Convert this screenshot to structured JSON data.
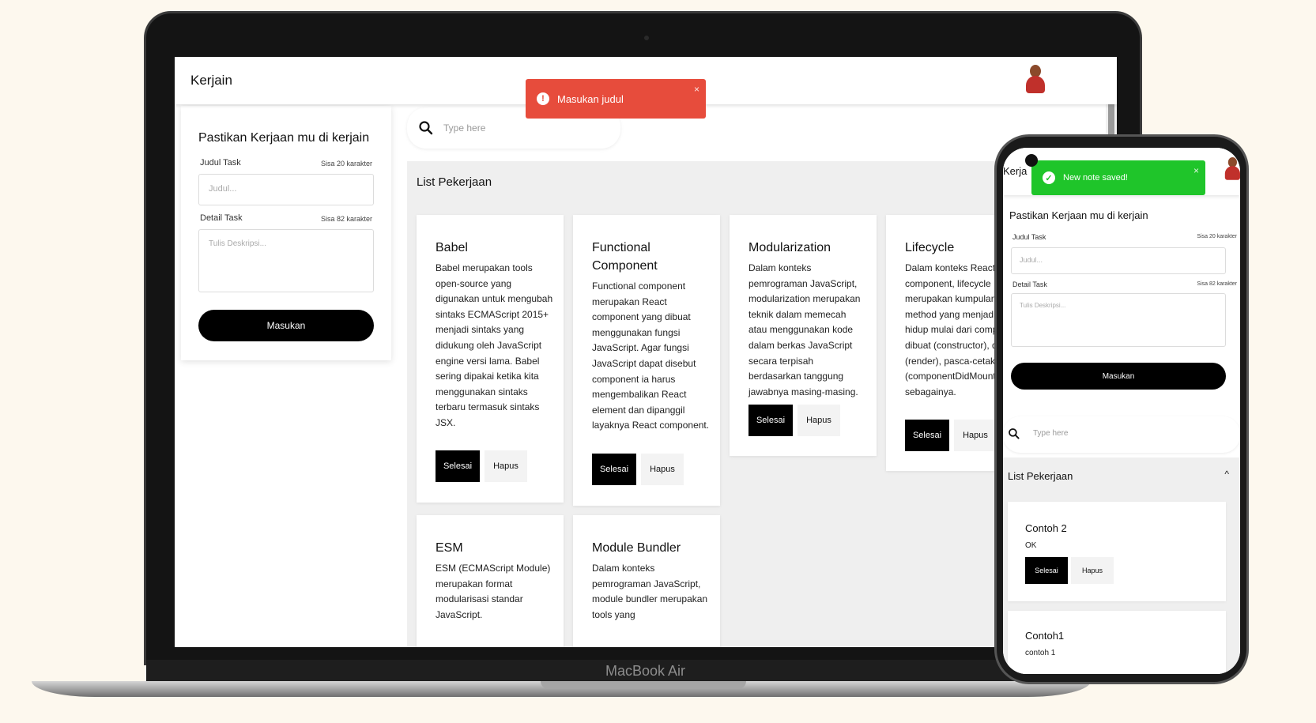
{
  "laptop": {
    "brand": "MacBook Air"
  },
  "app": {
    "title": "Kerjain"
  },
  "toast_error": {
    "icon": "!",
    "message": "Masukan judul",
    "close": "×",
    "color": "#e74c3c"
  },
  "toast_success": {
    "icon": "✓",
    "message": "New note saved!",
    "close": "×",
    "color": "#1fc52a"
  },
  "form": {
    "title": "Pastikan Kerjaan mu di kerjain",
    "title_label": "Judul Task",
    "title_count": "Sisa 20 karakter",
    "title_placeholder": "Judul...",
    "detail_label": "Detail Task",
    "detail_count": "Sisa 82 karakter",
    "detail_placeholder": "Tulis Deskripsi...",
    "submit": "Masukan"
  },
  "search": {
    "placeholder": "Type here"
  },
  "list": {
    "title": "List Pekerjaan",
    "done_label": "Selesai",
    "delete_label": "Hapus",
    "cards": [
      {
        "title": "Babel",
        "desc": "Babel merupakan tools open-source yang digunakan untuk mengubah sintaks ECMAScript 2015+ menjadi sintaks yang didukung oleh JavaScript engine versi lama. Babel sering dipakai ketika kita menggunakan sintaks terbaru termasuk sintaks JSX."
      },
      {
        "title": "Functional Component",
        "desc": "Functional component merupakan React component yang dibuat menggunakan fungsi JavaScript. Agar fungsi JavaScript dapat disebut component ia harus mengembalikan React element dan dipanggil layaknya React component."
      },
      {
        "title": "Modularization",
        "desc": "Dalam konteks pemrograman JavaScript, modularization merupakan teknik dalam memecah atau menggunakan kode dalam berkas JavaScript secara terpisah berdasarkan tanggung jawabnya masing-masing."
      },
      {
        "title": "Lifecycle",
        "desc": "Dalam konteks React component, lifecycle merupakan kumpulan method yang menjadi siklus hidup mulai dari component dibuat (constructor), dicetak (render), pasca-cetak (componentDidMount), dan sebagainya."
      },
      {
        "title": "ESM",
        "desc": "ESM (ECMAScript Module) merupakan format modularisasi standar JavaScript."
      },
      {
        "title": "Module Bundler",
        "desc": "Dalam konteks pemrograman JavaScript, module bundler merupakan tools yang"
      }
    ]
  },
  "phone": {
    "brand": "Kerja",
    "list_chevron": "^",
    "cards": [
      {
        "title": "Contoh 2",
        "desc": "OK"
      },
      {
        "title": "Contoh1",
        "desc": "contoh 1"
      }
    ]
  }
}
